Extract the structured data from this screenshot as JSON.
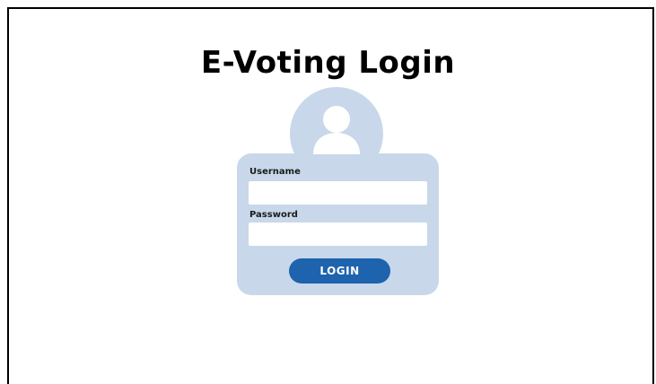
{
  "page": {
    "title": "E-Voting Login"
  },
  "form": {
    "username_label": "Username",
    "username_value": "",
    "password_label": "Password",
    "password_value": "",
    "login_label": "LOGIN"
  },
  "icons": {
    "avatar": "user-avatar-icon"
  },
  "colors": {
    "card": "#c8d8ea",
    "avatar_figure": "#ffffff",
    "button": "#1e63ad",
    "button_text": "#ffffff",
    "title": "#000000",
    "border": "#000000"
  }
}
